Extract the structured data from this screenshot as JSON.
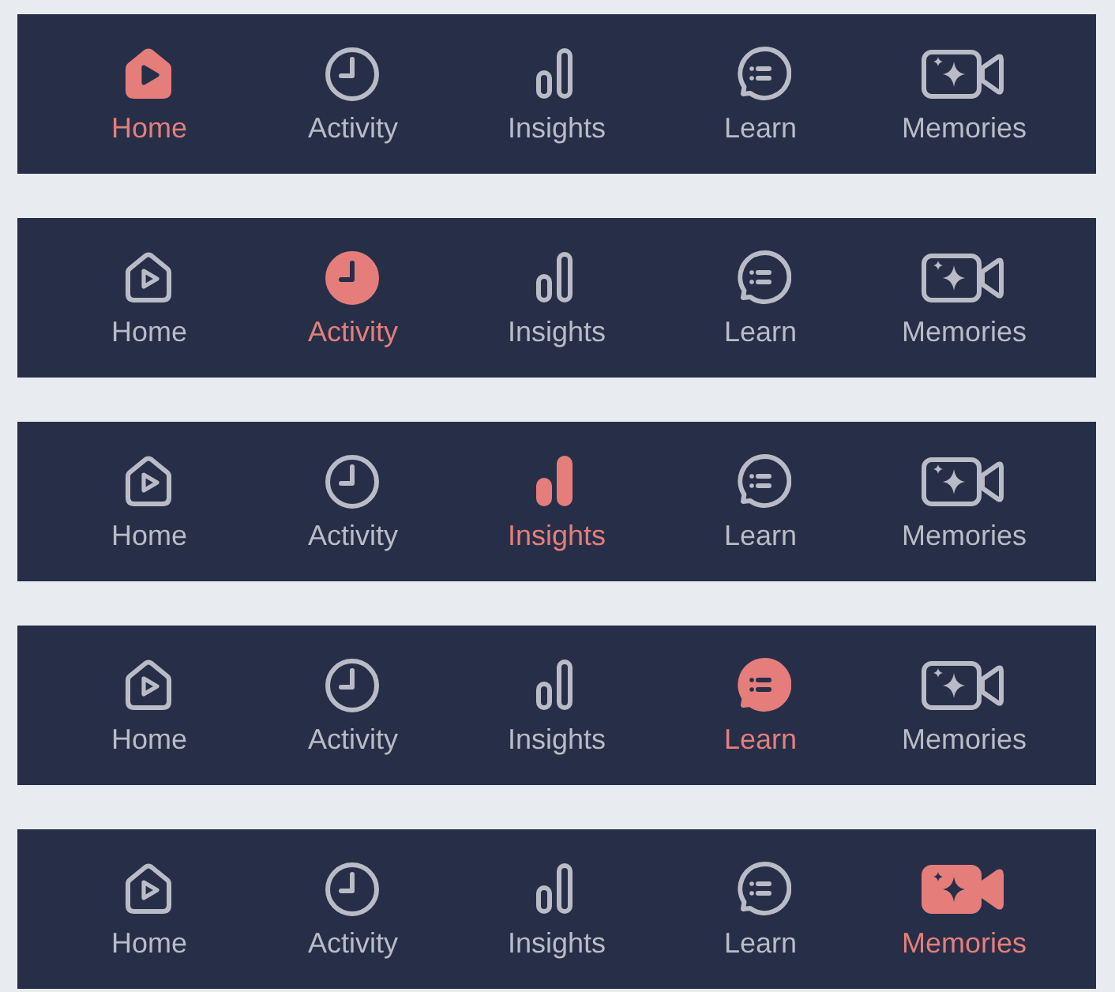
{
  "tab_bars": [
    {
      "items": [
        {
          "kind": "home",
          "label": "Home",
          "selected": true
        },
        {
          "kind": "activity",
          "label": "Activity",
          "selected": false
        },
        {
          "kind": "insights",
          "label": "Insights",
          "selected": false
        },
        {
          "kind": "learn",
          "label": "Learn",
          "selected": false
        },
        {
          "kind": "memories",
          "label": "Memories",
          "selected": false
        }
      ]
    },
    {
      "items": [
        {
          "kind": "home",
          "label": "Home",
          "selected": false
        },
        {
          "kind": "activity",
          "label": "Activity",
          "selected": true
        },
        {
          "kind": "insights",
          "label": "Insights",
          "selected": false
        },
        {
          "kind": "learn",
          "label": "Learn",
          "selected": false
        },
        {
          "kind": "memories",
          "label": "Memories",
          "selected": false
        }
      ]
    },
    {
      "items": [
        {
          "kind": "home",
          "label": "Home",
          "selected": false
        },
        {
          "kind": "activity",
          "label": "Activity",
          "selected": false
        },
        {
          "kind": "insights",
          "label": "Insights",
          "selected": true
        },
        {
          "kind": "learn",
          "label": "Learn",
          "selected": false
        },
        {
          "kind": "memories",
          "label": "Memories",
          "selected": false
        }
      ]
    },
    {
      "items": [
        {
          "kind": "home",
          "label": "Home",
          "selected": false
        },
        {
          "kind": "activity",
          "label": "Activity",
          "selected": false
        },
        {
          "kind": "insights",
          "label": "Insights",
          "selected": false
        },
        {
          "kind": "learn",
          "label": "Learn",
          "selected": true
        },
        {
          "kind": "memories",
          "label": "Memories",
          "selected": false
        }
      ]
    },
    {
      "items": [
        {
          "kind": "home",
          "label": "Home",
          "selected": false
        },
        {
          "kind": "activity",
          "label": "Activity",
          "selected": false
        },
        {
          "kind": "insights",
          "label": "Insights",
          "selected": false
        },
        {
          "kind": "learn",
          "label": "Learn",
          "selected": false
        },
        {
          "kind": "memories",
          "label": "Memories",
          "selected": true
        }
      ]
    }
  ]
}
